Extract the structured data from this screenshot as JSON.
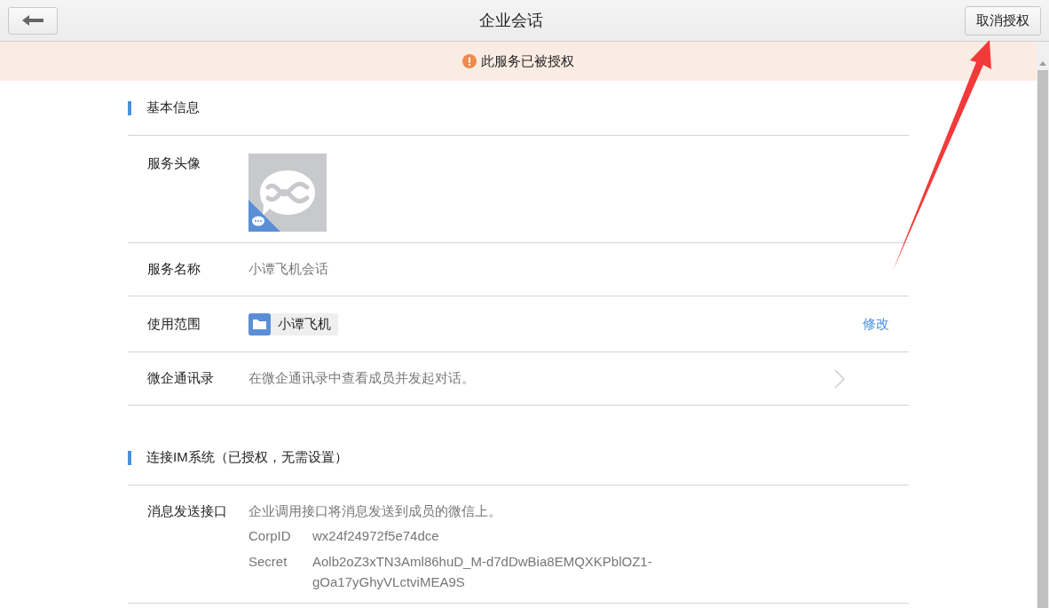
{
  "header": {
    "title": "企业会话",
    "action_button": "取消授权"
  },
  "notice": {
    "text": "此服务已被授权"
  },
  "sections": [
    {
      "title": "基本信息",
      "rows": [
        {
          "kind": "avatar",
          "label": "服务头像"
        },
        {
          "kind": "text",
          "label": "服务名称",
          "value": "小谭飞机会话"
        },
        {
          "kind": "scope",
          "label": "使用范围",
          "tag": "小谭飞机",
          "action": "修改"
        },
        {
          "kind": "link",
          "label": "微企通讯录",
          "value": "在微企通讯录中查看成员并发起对话。"
        }
      ]
    },
    {
      "title": "连接IM系统（已授权，无需设置）",
      "rows": [
        {
          "kind": "api",
          "label": "消息发送接口",
          "value": "企业调用接口将消息发送到成员的微信上。",
          "fields": [
            {
              "name": "CorpID",
              "value": "wx24f24972f5e74dce"
            },
            {
              "name": "Secret",
              "value": "Aolb2oZ3xTN3Aml86huD_M-d7dDwBia8EMQXKPblOZ1-gOa17yGhyVLctviMEA9S"
            }
          ]
        }
      ]
    }
  ]
}
